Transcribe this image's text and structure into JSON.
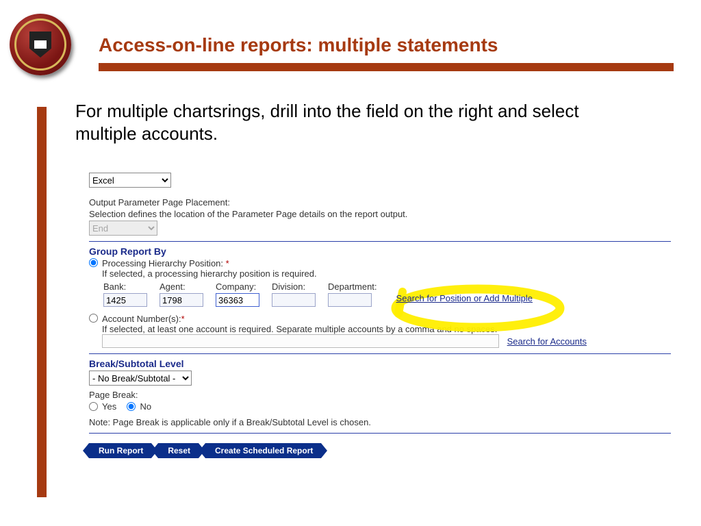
{
  "slide": {
    "title": "Access-on-line reports: multiple statements",
    "intro": "For multiple chartsrings, drill into the field  on the right and select multiple accounts."
  },
  "form": {
    "format_select": "Excel",
    "output_pp_label": "Output Parameter Page Placement:",
    "output_pp_help": "Selection defines the location of the Parameter Page details on the report output.",
    "placement_select": "End",
    "group_section_title": "Group Report By",
    "group": {
      "proc_hier_label": "Processing Hierarchy Position:",
      "proc_help": "If selected, a processing hierarchy position is required.",
      "cols": {
        "bank_label": "Bank:",
        "bank_value": "1425",
        "agent_label": "Agent:",
        "agent_value": "1798",
        "company_label": "Company:",
        "company_value": "36363",
        "division_label": "Division:",
        "division_value": "",
        "department_label": "Department:",
        "department_value": ""
      },
      "search_pos_link": "Search for Position or Add Multiple",
      "acct_label": "Account Number(s):",
      "acct_help": "If selected, at least one account is required. Separate multiple accounts by a comma and no spaces.",
      "search_accts_link": "Search for Accounts"
    },
    "break_section_title": "Break/Subtotal Level",
    "break_select": "- No Break/Subtotal -",
    "page_break_label": "Page Break:",
    "yes_label": "Yes",
    "no_label": "No",
    "note": "Note: Page Break is applicable only if a Break/Subtotal Level is chosen.",
    "buttons": {
      "run": "Run Report",
      "reset": "Reset",
      "sched": "Create Scheduled Report"
    }
  },
  "annotation": {
    "target": "search-position-link"
  }
}
